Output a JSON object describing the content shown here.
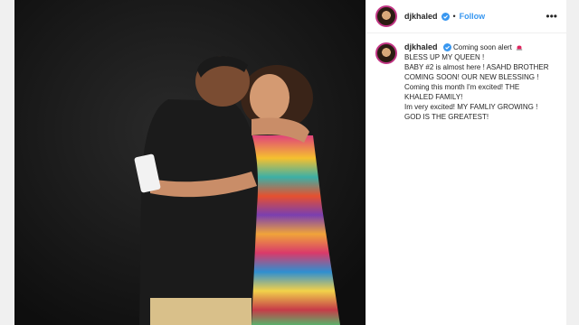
{
  "post": {
    "username": "djkhaled",
    "follow_label": "Follow",
    "separator": "•",
    "more_label": "•••",
    "caption": {
      "first_line": "Coming soon alert",
      "lines": [
        "BLESS UP MY QUEEN !",
        "BABY #2 is almost here ! ASAHD BROTHER COMING SOON! OUR NEW BLESSING ! Coming this month I'm excited! THE KHALED FAMILY!",
        "Im very excited! MY FAMLIY GROWING !",
        "GOD IS THE GREATEST!"
      ]
    }
  },
  "colors": {
    "link": "#3897f0",
    "verified": "#3897f0",
    "text": "#262626",
    "siren": "#e0245e"
  },
  "icons": {
    "verified": "verified-badge-icon",
    "siren": "siren-emoji-icon",
    "more": "more-options-icon"
  }
}
